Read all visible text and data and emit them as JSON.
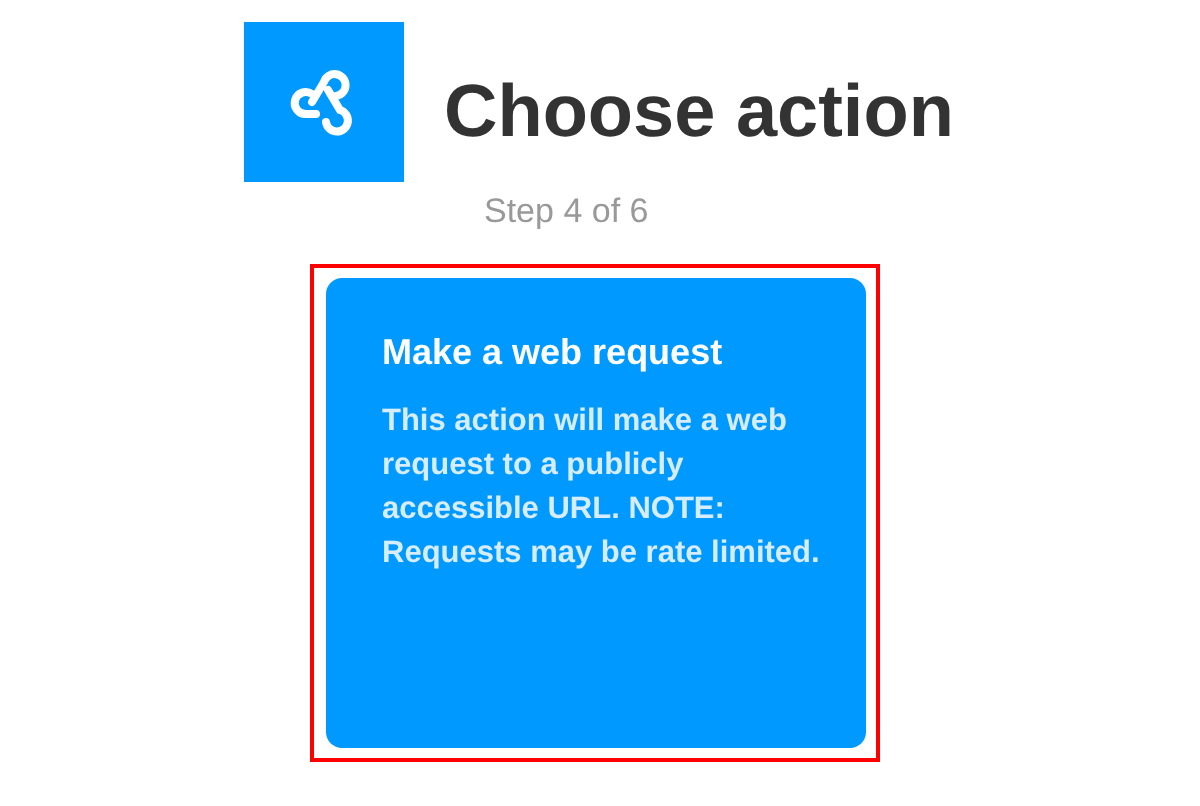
{
  "header": {
    "title": "Choose action",
    "step": "Step 4 of 6"
  },
  "actions": [
    {
      "title": "Make a web request",
      "description": "This action will make a web request to a publicly accessible URL. NOTE: Requests may be rate limited.",
      "selected": true
    }
  ]
}
